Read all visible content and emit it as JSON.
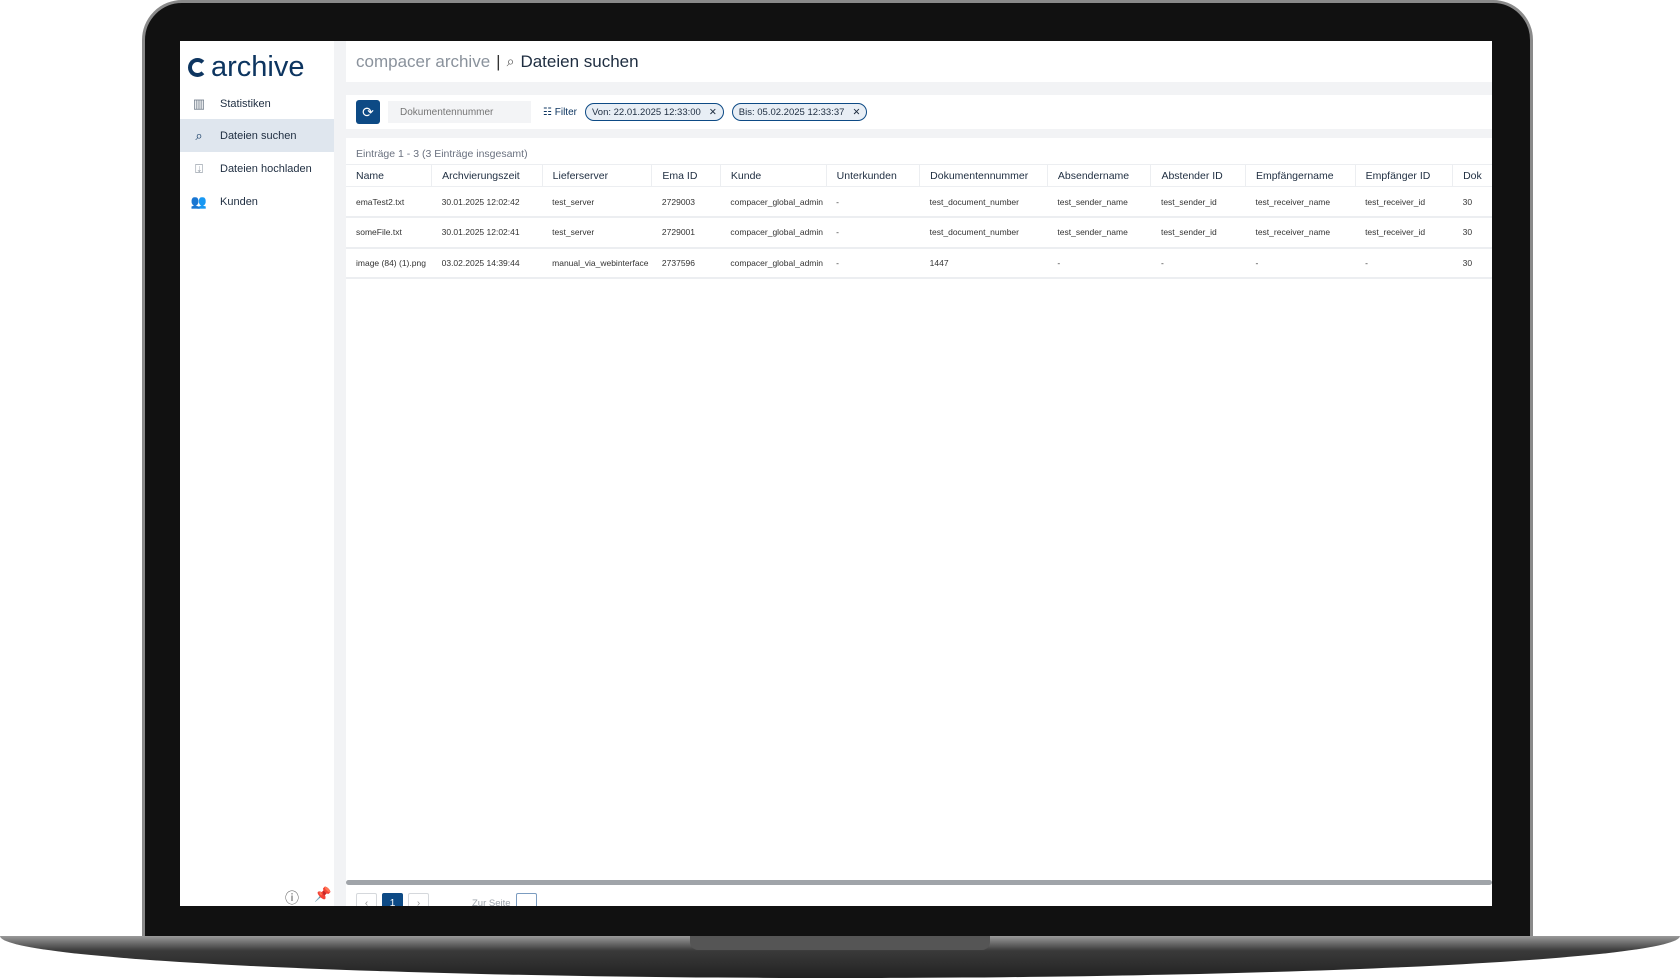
{
  "app": {
    "logo": "archive",
    "breadcrumb_app": "compacer archive",
    "breadcrumb_sep": "|",
    "page_title": "Dateien suchen"
  },
  "sidebar": {
    "items": [
      {
        "label": "Statistiken",
        "icon": "bar-chart-icon"
      },
      {
        "label": "Dateien suchen",
        "icon": "search-icon",
        "active": true
      },
      {
        "label": "Dateien hochladen",
        "icon": "upload-icon"
      },
      {
        "label": "Kunden",
        "icon": "people-icon"
      }
    ]
  },
  "toolbar": {
    "search_placeholder": "Dokumentennummer",
    "filter_label": "Filter",
    "chips": [
      "Von: 22.01.2025 12:33:00",
      "Bis: 05.02.2025 12:33:37"
    ]
  },
  "table": {
    "count": "Einträge 1 - 3 (3 Einträge insgesamt)",
    "columns": [
      "Name",
      "Archvierungszeit",
      "Lieferserver",
      "Ema ID",
      "Kunde",
      "Unterkunden",
      "Dokumentennummer",
      "Absendername",
      "Abstender ID",
      "Empfängername",
      "Empfänger ID",
      "Dok"
    ],
    "rows": [
      [
        "emaTest2.txt",
        "30.01.2025 12:02:42",
        "test_server",
        "2729003",
        "compacer_global_admin",
        "-",
        "test_document_number",
        "test_sender_name",
        "test_sender_id",
        "test_receiver_name",
        "test_receiver_id",
        "30"
      ],
      [
        "someFile.txt",
        "30.01.2025 12:02:41",
        "test_server",
        "2729001",
        "compacer_global_admin",
        "-",
        "test_document_number",
        "test_sender_name",
        "test_sender_id",
        "test_receiver_name",
        "test_receiver_id",
        "30"
      ],
      [
        "image (84) (1).png",
        "03.02.2025 14:39:44",
        "manual_via_webinterface",
        "2737596",
        "compacer_global_admin",
        "-",
        "1447",
        "-",
        "-",
        "-",
        "-",
        "30"
      ]
    ]
  },
  "pagination": {
    "prev": "‹",
    "current": "1",
    "next": "›",
    "goto_label": "Zur Seite"
  },
  "colors": {
    "brand": "#0d4a85",
    "active_nav": "#dfe6ee"
  }
}
